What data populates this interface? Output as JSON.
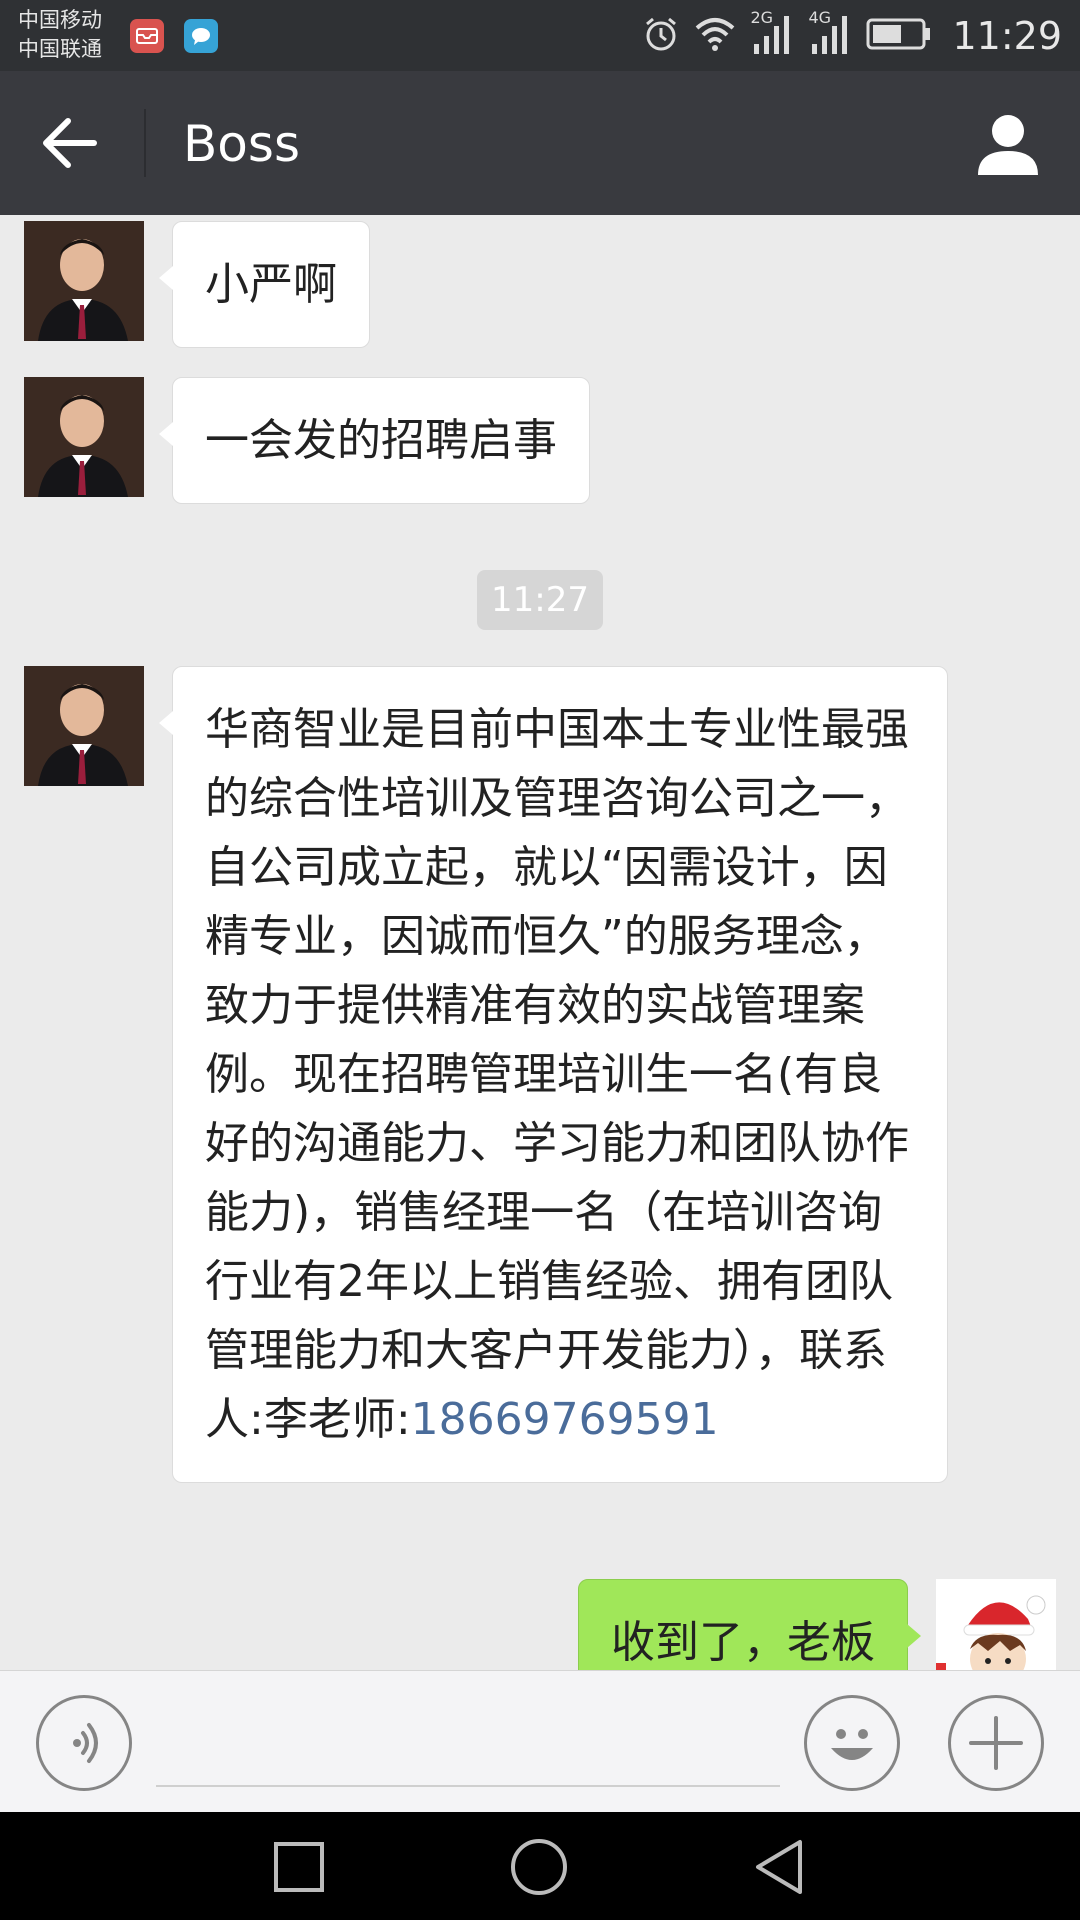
{
  "status_bar": {
    "carrier1": "中国移动",
    "carrier2": "中国联通",
    "signal1_label": "2G",
    "signal2_label": "4G",
    "time": "11:29",
    "icons": [
      "mail-notification-icon",
      "message-notification-icon",
      "alarm-icon",
      "wifi-icon",
      "signal-icon",
      "signal-icon",
      "battery-icon"
    ]
  },
  "nav": {
    "title": "Boss",
    "back_icon": "arrow-left-icon",
    "profile_icon": "person-icon"
  },
  "messages": [
    {
      "sender": "other",
      "text": "小严啊"
    },
    {
      "sender": "other",
      "text": "一会发的招聘启事"
    },
    {
      "type": "timestamp",
      "text": "11:27"
    },
    {
      "sender": "other",
      "text": "华商智业是目前中国本土专业性最强的综合性培训及管理咨询公司之一，自公司成立起，就以“因需设计，因精专业，因诚而恒久”的服务理念，致力于提供精准有效的实战管理案例。现在招聘管理培训生一名(有良好的沟通能力、学习能力和团队协作能力)，销售经理一名（在培训咨询行业有2年以上销售经验、拥有团队管理能力和大客户开发能力），联系人:李老师:",
      "phone": "18669769591"
    },
    {
      "sender": "me",
      "text": "收到了，老板"
    }
  ],
  "input_bar": {
    "value": "",
    "icons": [
      "voice-icon",
      "emoji-icon",
      "plus-icon"
    ]
  },
  "system_nav": {
    "icons": [
      "recent-apps-icon",
      "home-icon",
      "back-icon"
    ]
  },
  "colors": {
    "status_bar_bg": "#2f3134",
    "nav_bg": "#393a3f",
    "chat_bg": "#ebebeb",
    "my_bubble": "#a0e759",
    "link": "#4a6c9a"
  }
}
